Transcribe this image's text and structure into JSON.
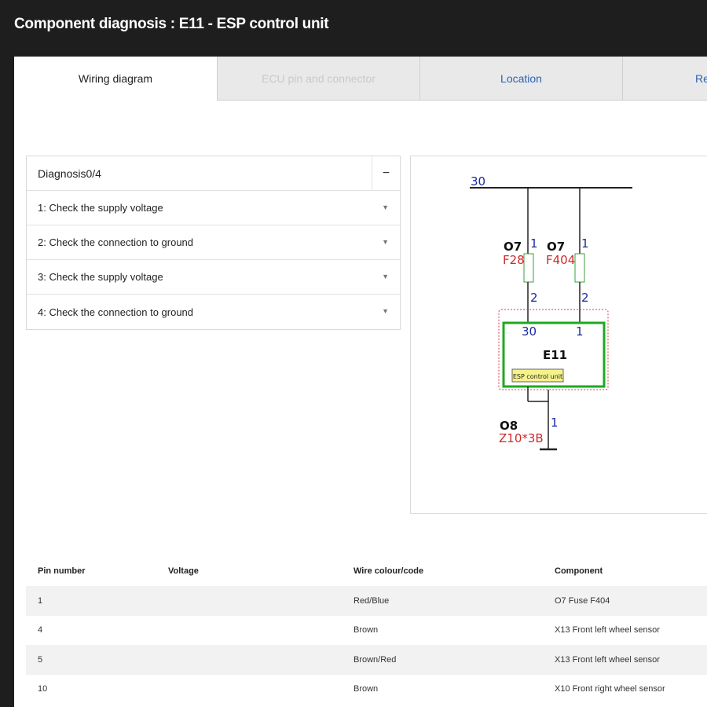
{
  "header": {
    "title": "Component diagnosis : E11 - ESP control unit"
  },
  "tabs": [
    {
      "label": "Wiring diagram",
      "state": "active"
    },
    {
      "label": "ECU pin and connector",
      "state": "disabled"
    },
    {
      "label": "Location",
      "state": "normal"
    },
    {
      "label": "Rel",
      "state": "normal"
    }
  ],
  "diagnosis": {
    "title": "Diagnosis0/4",
    "collapse_symbol": "−",
    "steps": [
      {
        "label": "1: Check the supply voltage"
      },
      {
        "label": "2: Check the connection to ground"
      },
      {
        "label": "3: Check the supply voltage"
      },
      {
        "label": "4: Check the connection to ground"
      }
    ]
  },
  "diagram": {
    "bus_label": "30",
    "fuse_left": {
      "group": "O7",
      "name": "F28",
      "pin_top": "1",
      "pin_bottom": "2"
    },
    "fuse_right": {
      "group": "O7",
      "name": "F404",
      "pin_top": "1",
      "pin_bottom": "2"
    },
    "unit": {
      "name": "E11",
      "tag": "ESP control unit",
      "pin_left": "30",
      "pin_right": "1"
    },
    "ground": {
      "group": "O8",
      "name": "Z10*3B",
      "pin": "1"
    },
    "colors": {
      "wire": "#222222",
      "fuse": "#3aa03a",
      "unit_box": "#1fa81f",
      "dotted": "#d0404a",
      "label_red": "#cc2a2a",
      "label_blue": "#1a2aa0",
      "tag_bg": "#f5f28a"
    }
  },
  "table": {
    "headers": [
      "Pin number",
      "Voltage",
      "Wire colour/code",
      "Component"
    ],
    "rows": [
      [
        "1",
        "",
        "Red/Blue",
        "O7 Fuse F404"
      ],
      [
        "4",
        "",
        "Brown",
        "X13 Front left wheel sensor"
      ],
      [
        "5",
        "",
        "Brown/Red",
        "X13 Front left wheel sensor"
      ],
      [
        "10",
        "",
        "Brown",
        "X10 Front right wheel sensor"
      ]
    ]
  }
}
